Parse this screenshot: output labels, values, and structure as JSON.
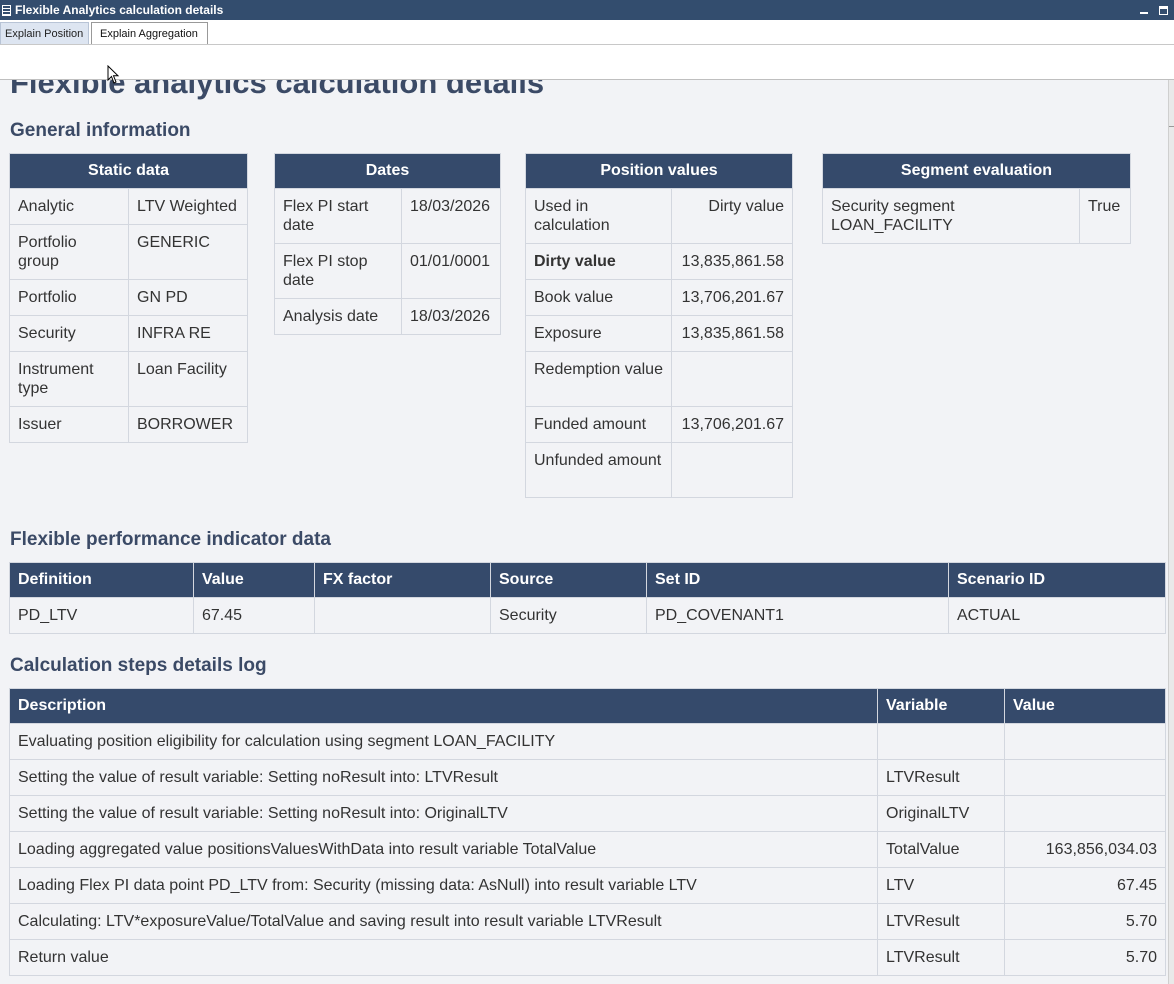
{
  "window": {
    "title": "Flexible Analytics calculation details"
  },
  "tabs": [
    "Explain Position",
    "Explain Aggregation"
  ],
  "page_title": "Flexible analytics calculation details",
  "general_info_title": "General information",
  "static_data": {
    "header": "Static data",
    "rows": [
      [
        "Analytic",
        "LTV Weighted"
      ],
      [
        "Portfolio group",
        "GENERIC"
      ],
      [
        "Portfolio",
        "GN PD"
      ],
      [
        "Security",
        "INFRA RE"
      ],
      [
        "Instrument type",
        "Loan Facility"
      ],
      [
        "Issuer",
        "BORROWER"
      ]
    ]
  },
  "dates": {
    "header": "Dates",
    "rows": [
      [
        "Flex PI start date",
        "18/03/2026"
      ],
      [
        "Flex PI stop date",
        "01/01/0001"
      ],
      [
        "Analysis date",
        "18/03/2026"
      ]
    ]
  },
  "position_values": {
    "header": "Position values",
    "rows": [
      [
        "Used in calculation",
        "Dirty value"
      ],
      [
        "Dirty value",
        "13,835,861.58"
      ],
      [
        "Book value",
        "13,706,201.67"
      ],
      [
        "Exposure",
        "13,835,861.58"
      ],
      [
        "Redemption value",
        ""
      ],
      [
        "Funded amount",
        "13,706,201.67"
      ],
      [
        "Unfunded amount",
        ""
      ]
    ]
  },
  "segment_evaluation": {
    "header": "Segment evaluation",
    "rows": [
      [
        "Security segment LOAN_FACILITY",
        "True"
      ]
    ]
  },
  "flex_pi_title": "Flexible performance indicator data",
  "flex_pi": {
    "headers": [
      "Definition",
      "Value",
      "FX factor",
      "Source",
      "Set ID",
      "Scenario ID"
    ],
    "rows": [
      [
        "PD_LTV",
        "67.45",
        "",
        "Security",
        "PD_COVENANT1",
        "ACTUAL"
      ]
    ]
  },
  "calc_log_title": "Calculation steps details log",
  "calc_log": {
    "headers": [
      "Description",
      "Variable",
      "Value"
    ],
    "rows": [
      [
        "Evaluating position eligibility for calculation using segment LOAN_FACILITY",
        "",
        ""
      ],
      [
        "Setting the value of result variable: Setting noResult into: LTVResult",
        "LTVResult",
        ""
      ],
      [
        "Setting the value of result variable: Setting noResult into: OriginalLTV",
        "OriginalLTV",
        ""
      ],
      [
        "Loading aggregated value positionsValuesWithData into result variable TotalValue",
        "TotalValue",
        "163,856,034.03"
      ],
      [
        "Loading Flex PI data point PD_LTV from: Security (missing data: AsNull) into result variable LTV",
        "LTV",
        "67.45"
      ],
      [
        "Calculating: LTV*exposureValue/TotalValue and saving result into result variable LTVResult",
        "LTVResult",
        "5.70"
      ],
      [
        "Return value",
        "LTVResult",
        "5.70"
      ]
    ]
  }
}
